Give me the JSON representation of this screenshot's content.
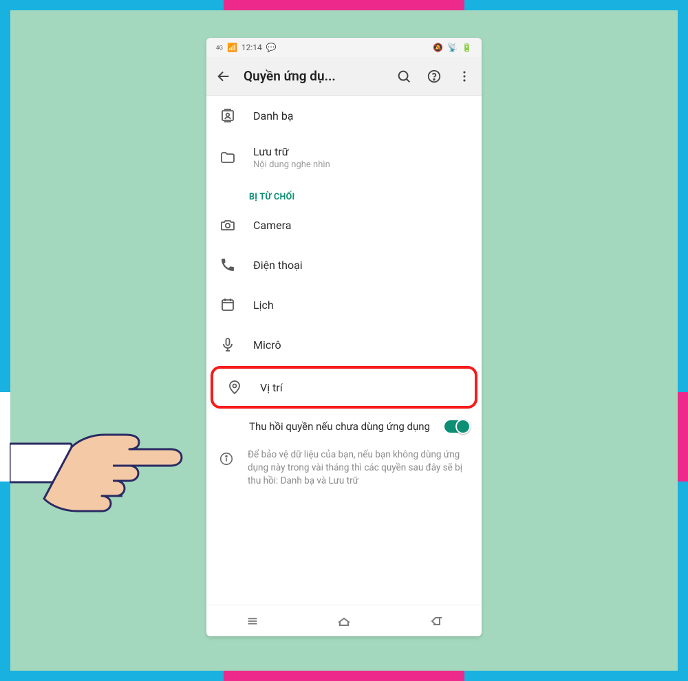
{
  "statusbar": {
    "time": "12:14",
    "net_label": "4G"
  },
  "appbar": {
    "title": "Quyền ứng dụ..."
  },
  "allowed": [
    {
      "icon": "contacts",
      "label": "Danh bạ",
      "sub": ""
    },
    {
      "icon": "folder",
      "label": "Lưu trữ",
      "sub": "Nội dung nghe nhìn"
    }
  ],
  "denied_header": "BỊ TỪ CHỐI",
  "denied": [
    {
      "icon": "camera",
      "label": "Camera"
    },
    {
      "icon": "phone",
      "label": "Điện thoại"
    },
    {
      "icon": "calendar",
      "label": "Lịch"
    },
    {
      "icon": "mic",
      "label": "Micrô"
    },
    {
      "icon": "location",
      "label": "Vị trí",
      "highlight": true
    }
  ],
  "toggle": {
    "label": "Thu hồi quyền nếu chưa dùng ứng dụng",
    "on": true
  },
  "footer": "Để bảo vệ dữ liệu của bạn, nếu bạn không dùng ứng dụng này trong vài tháng thì các quyền sau đây sẽ bị thu hồi: Danh bạ và Lưu trữ"
}
